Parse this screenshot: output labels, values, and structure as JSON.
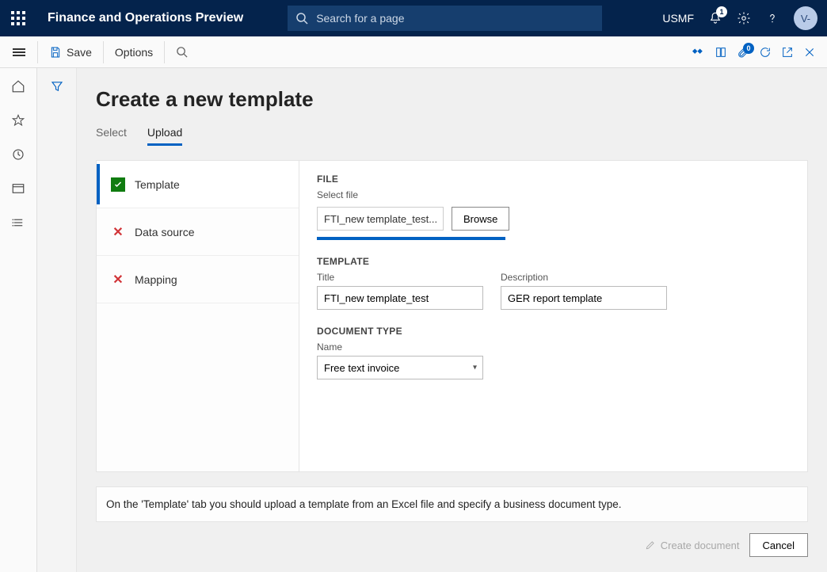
{
  "header": {
    "app_title": "Finance and Operations Preview",
    "search_placeholder": "Search for a page",
    "company": "USMF",
    "bell_count": "1",
    "avatar_initials": "V-"
  },
  "toolbar": {
    "save_label": "Save",
    "options_label": "Options",
    "doc_badge": "0"
  },
  "page": {
    "title": "Create a new template",
    "tabs": {
      "select": "Select",
      "upload": "Upload"
    },
    "steps": {
      "template": "Template",
      "datasource": "Data source",
      "mapping": "Mapping"
    },
    "file": {
      "section": "FILE",
      "select_label": "Select file",
      "filename": "FTI_new template_test...",
      "browse": "Browse"
    },
    "template": {
      "section": "TEMPLATE",
      "title_label": "Title",
      "title_value": "FTI_new template_test",
      "desc_label": "Description",
      "desc_value": "GER report template"
    },
    "doctype": {
      "section": "DOCUMENT TYPE",
      "name_label": "Name",
      "name_value": "Free text invoice"
    },
    "hint": "On the 'Template' tab you should upload a template from an Excel file and specify a business document type.",
    "create_label": "Create document",
    "cancel_label": "Cancel"
  }
}
